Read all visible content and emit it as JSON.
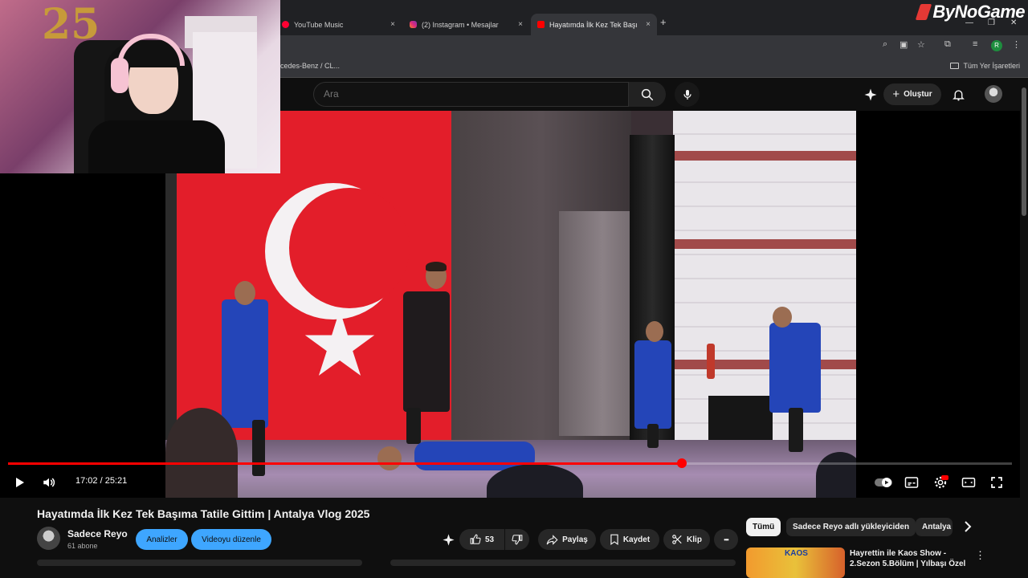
{
  "browser": {
    "tabs": [
      {
        "label": "YouTube Music",
        "icon": "youtube-music-icon"
      },
      {
        "label": "(2) Instagram • Mesajlar",
        "icon": "instagram-icon"
      },
      {
        "label": "Hayatımda İlk Kez Tek Başıma T",
        "icon": "youtube-icon"
      }
    ],
    "new_tab": "+",
    "close_glyph": "×",
    "bookmark_partial": "cedes-Benz / CL...",
    "bookmarks_folder": "Tüm Yer İşaretleri",
    "profile_initial": "R"
  },
  "watermark": {
    "brand": "ByNoGame"
  },
  "webcam": {
    "balloon_number": "25"
  },
  "header": {
    "search_placeholder": "Ara",
    "create_label": "Oluştur"
  },
  "player": {
    "current_time": "17:02",
    "duration": "25:21",
    "time_display": "17:02 / 25:21",
    "progress_fraction": 0.671
  },
  "video_info": {
    "title": "Hayatımda İlk Kez Tek Başıma Tatile Gittim | Antalya Vlog 2025",
    "channel": "Sadece Reyo",
    "subscribers": "61 abone",
    "analytics_label": "Analizler",
    "edit_label": "Videoyu düzenle",
    "like_count": "53",
    "share_label": "Paylaş",
    "save_label": "Kaydet",
    "clip_label": "Klip",
    "more_glyph": "•••"
  },
  "recommendations": {
    "chips": [
      "Tümü",
      "Sadece Reyo adlı yükleyiciden",
      "Antalya"
    ],
    "items": [
      {
        "title": "Hayrettin ile Kaos Show - 2.Sezon 5.Bölüm | Yılbaşı Özel",
        "thumb_text": "KAOS"
      }
    ]
  },
  "colors": {
    "accent_red": "#ff0000",
    "blue_button": "#3ea6ff",
    "background": "#0f0f0f"
  }
}
